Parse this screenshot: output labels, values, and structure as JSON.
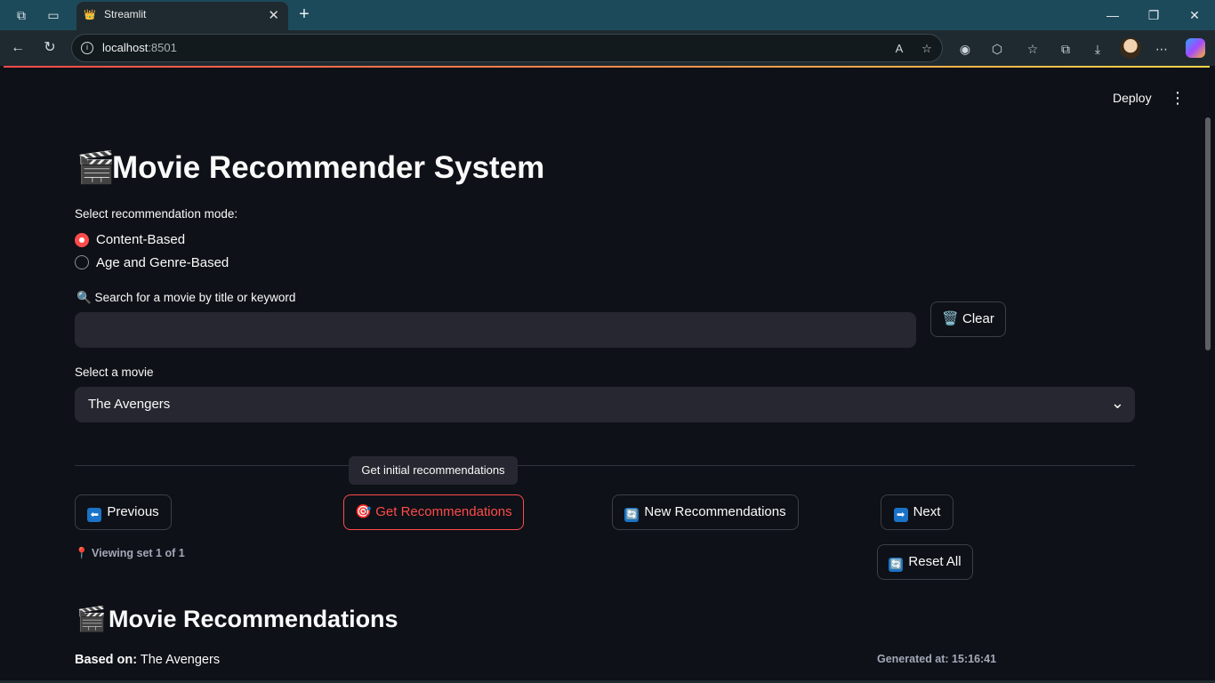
{
  "browser": {
    "tab_title": "Streamlit",
    "tab_close": "✕",
    "new_tab": "+",
    "address": "localhost",
    "address_port": ":8501",
    "window_controls": [
      "—",
      "❐",
      "✕"
    ]
  },
  "header": {
    "deploy_label": "Deploy",
    "menu_icon": "⋮"
  },
  "main": {
    "title_emoji": "🎬",
    "title": "Movie Recommender System",
    "mode_label": "Select recommendation mode:",
    "modes": [
      {
        "label": "Content-Based",
        "selected": true
      },
      {
        "label": "Age and Genre-Based",
        "selected": false
      }
    ],
    "search_label": "🔍 Search for a movie by title or keyword",
    "search_value": "",
    "clear_label": "Clear",
    "clear_icon": "🗑️",
    "select_label": "Select a movie",
    "select_value": "The Avengers",
    "tooltip": "Get initial recommendations",
    "buttons": {
      "previous": {
        "icon": "⬅",
        "label": "Previous"
      },
      "get": {
        "icon": "🎯",
        "label": "Get Recommendations"
      },
      "new": {
        "icon": "🔄",
        "label": "New Recommendations"
      },
      "next": {
        "icon": "➡",
        "label": "Next"
      },
      "reset": {
        "icon": "🔄",
        "label": "Reset All"
      }
    },
    "viewing_caption": "📍 Viewing set 1 of 1",
    "recs_emoji": "🎬",
    "recs_title": "Movie Recommendations",
    "based_on_label": "Based on:",
    "based_on_value": " The Avengers",
    "generated_at": "Generated at: 15:16:41"
  },
  "colors": {
    "accent": "#ff4b4b",
    "background": "#0e1117",
    "input_bg": "#262730"
  }
}
